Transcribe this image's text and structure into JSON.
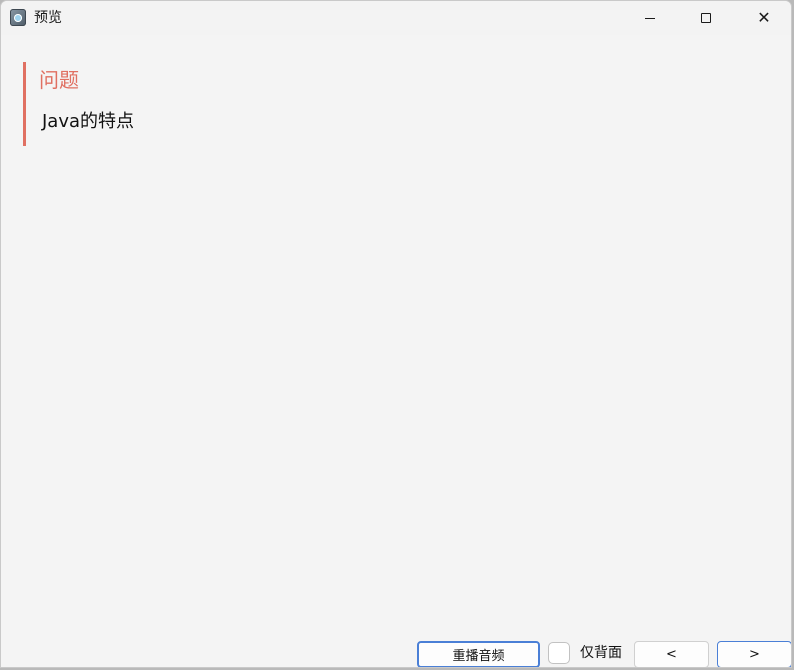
{
  "window": {
    "title": "预览",
    "app_icon": "app-icon",
    "controls": {
      "minimize": "minimize-icon",
      "maximize": "maximize-icon",
      "close": "close-icon"
    }
  },
  "card": {
    "label": "问题",
    "text": "Java的特点",
    "accent_color": "#e07062"
  },
  "footer": {
    "replay_label": "重播音频",
    "back_only_label": "仅背面",
    "back_only_checked": false,
    "prev_label": "<",
    "next_label": ">"
  }
}
